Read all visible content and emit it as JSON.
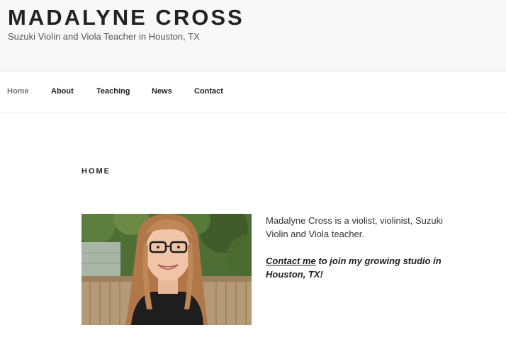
{
  "header": {
    "title": "MADALYNE CROSS",
    "tagline": "Suzuki Violin and Viola Teacher in Houston, TX"
  },
  "nav": {
    "items": [
      {
        "label": "Home",
        "current": true
      },
      {
        "label": "About"
      },
      {
        "label": "Teaching"
      },
      {
        "label": "News"
      },
      {
        "label": "Contact"
      }
    ]
  },
  "page": {
    "title": "HOME",
    "intro": "Madalyne Cross is a violist, violinist, Suzuki Violin and Viola teacher.",
    "cta_link": "Contact me",
    "cta_rest": " to join my growing studio in Houston, TX!"
  },
  "colors": {
    "header_bg": "#f8f8f8",
    "text": "#222222",
    "nav_current": "#767676"
  }
}
